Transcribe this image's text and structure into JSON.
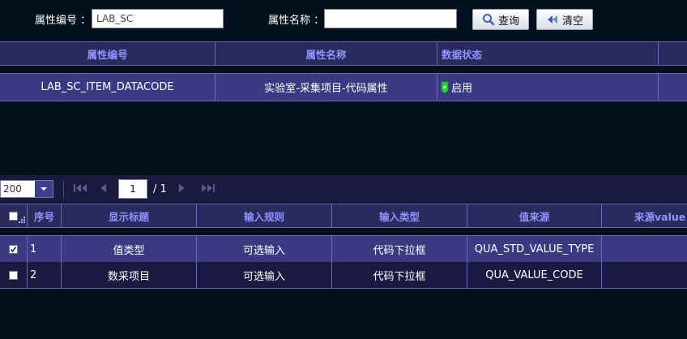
{
  "search": {
    "code_label": "属性编号 ：",
    "code_value": "LAB_SC",
    "name_label": "属性名称 ：",
    "name_value": "",
    "query_label": "查询",
    "clear_label": "清空"
  },
  "top_table": {
    "headers": [
      "属性编号",
      "属性名称",
      "数据状态"
    ],
    "rows": [
      {
        "code": "LAB_SC_ITEM_DATACODE",
        "name": "实验室-采集项目-代码属性",
        "status": "启用"
      }
    ]
  },
  "pager": {
    "page_size": "200",
    "current_page": "1",
    "total_pages": "/ 1"
  },
  "bottom_table": {
    "headers": [
      "序号",
      "显示标题",
      "输入规则",
      "输入类型",
      "值来源",
      "来源value"
    ],
    "rows": [
      {
        "checked": true,
        "index": "1",
        "title": "值类型",
        "rule": "可选输入",
        "type": "代码下拉框",
        "source": "QUA_STD_VALUE_TYPE"
      },
      {
        "checked": false,
        "index": "2",
        "title": "数采项目",
        "rule": "可选输入",
        "type": "代码下拉框",
        "source": "QUA_VALUE_CODE"
      }
    ]
  },
  "colors": {
    "background": "#02111d",
    "header_bg": "#2b2a5f",
    "header_text": "#8f94ff",
    "selected_row": "#3a3982",
    "row_bg": "#1a1942",
    "border": "#6a69b9",
    "status_green": "#2ecc40"
  }
}
